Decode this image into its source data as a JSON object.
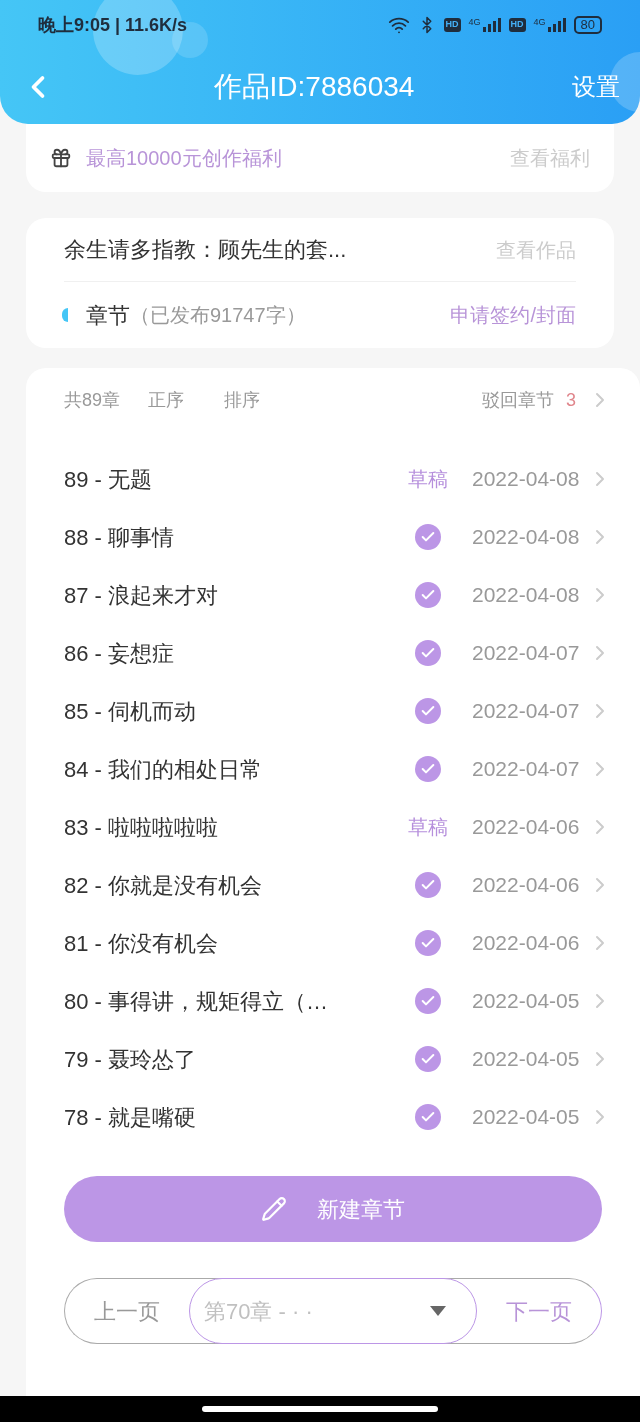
{
  "status_bar": {
    "time": "晚上9:05 | 11.6K/s",
    "hd_1": "HD",
    "net_1": "4G",
    "hd_2": "HD",
    "net_2": "4G",
    "battery": "80"
  },
  "header": {
    "title": "作品ID:7886034",
    "action": "设置"
  },
  "benefit": {
    "text": "最高10000元创作福利",
    "link": "查看福利"
  },
  "work": {
    "title": "余生请多指教：顾先生的套...",
    "link": "查看作品",
    "section": "章节",
    "count": "（已发布91747字）",
    "action": "申请签约/封面"
  },
  "toolbar": {
    "total": "共89章",
    "order": "正序",
    "sort": "排序",
    "rejected": "驳回章节",
    "rejected_count": "3"
  },
  "chapters": [
    {
      "title": "89 - 无题",
      "kind": "draft",
      "status": "草稿",
      "date": "2022-04-08"
    },
    {
      "title": "88 - 聊事情",
      "kind": "published",
      "date": "2022-04-08"
    },
    {
      "title": "87 - 浪起来才对",
      "kind": "published",
      "date": "2022-04-08"
    },
    {
      "title": "86 - 妄想症",
      "kind": "published",
      "date": "2022-04-07"
    },
    {
      "title": "85 - 伺机而动",
      "kind": "published",
      "date": "2022-04-07"
    },
    {
      "title": "84 - 我们的相处日常",
      "kind": "published",
      "date": "2022-04-07"
    },
    {
      "title": "83 - 啦啦啦啦啦",
      "kind": "draft",
      "status": "草稿",
      "date": "2022-04-06"
    },
    {
      "title": "82 - 你就是没有机会",
      "kind": "published",
      "date": "2022-04-06"
    },
    {
      "title": "81 - 你没有机会",
      "kind": "published",
      "date": "2022-04-06"
    },
    {
      "title": "80 - 事得讲，规矩得立（…",
      "kind": "published",
      "date": "2022-04-05"
    },
    {
      "title": "79 - 聂玲怂了",
      "kind": "published",
      "date": "2022-04-05"
    },
    {
      "title": "78 - 就是嘴硬",
      "kind": "published",
      "date": "2022-04-05"
    }
  ],
  "new_button": "新建章节",
  "pager": {
    "prev": "上一页",
    "select": "第70章 - · ·",
    "next": "下一页"
  }
}
